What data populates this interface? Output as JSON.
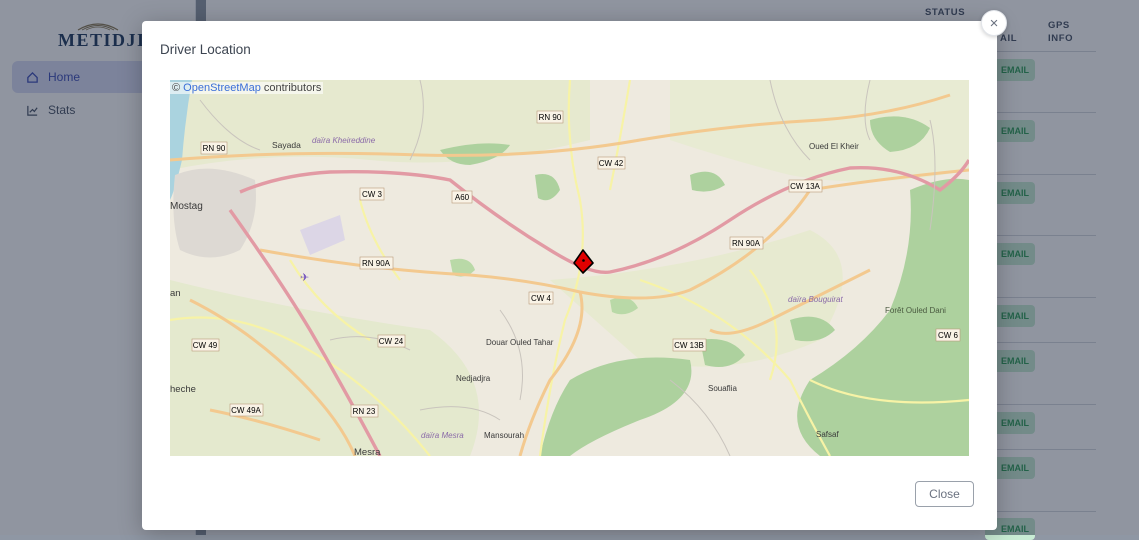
{
  "app": {
    "logo_text": "METIDJI",
    "nav": [
      {
        "label": "Home",
        "icon": "home-icon",
        "active": true
      },
      {
        "label": "Stats",
        "icon": "chart-icon",
        "active": false
      }
    ]
  },
  "table": {
    "headers": {
      "status": "STATUS",
      "email": "AIL",
      "gps_line1": "GPS",
      "gps_line2": "INFO"
    },
    "row_action": "EMAIL"
  },
  "modal": {
    "title": "Driver Location",
    "close_button": "Close",
    "close_icon": "×"
  },
  "map": {
    "attribution_prefix": "©",
    "attribution_link": "OpenStreetMap",
    "attribution_suffix": "contributors",
    "road_labels": [
      "RN 90",
      "RN 90",
      "CW 42",
      "A60",
      "CW 3",
      "CW 13A",
      "RN 90A",
      "RN 90A",
      "CW 4",
      "CW 13B",
      "CW 49",
      "CW 24",
      "CW 49A",
      "RN 23",
      "CW 6"
    ],
    "place_labels": [
      "Sayada",
      "daïra Kheireddine",
      "Mostaganem",
      "Oued El Kheir",
      "Douar Ouled Tahar",
      "Nedjadjra",
      "Souaflia",
      "Forêt Ouled Dani",
      "daïra Bouguirat",
      "Mansourah",
      "daïra Mesra",
      "Mesra",
      "Safsaf",
      "heche",
      "an",
      "Mostag"
    ],
    "marker_icon": "map-pin-icon"
  },
  "colors": {
    "primary_road": "#e89aa5",
    "secondary_road": "#f3c98f",
    "forest": "#a8d39a",
    "water": "#aad3df",
    "marker": "#e00000",
    "email_chip": "#c8ecd4"
  }
}
